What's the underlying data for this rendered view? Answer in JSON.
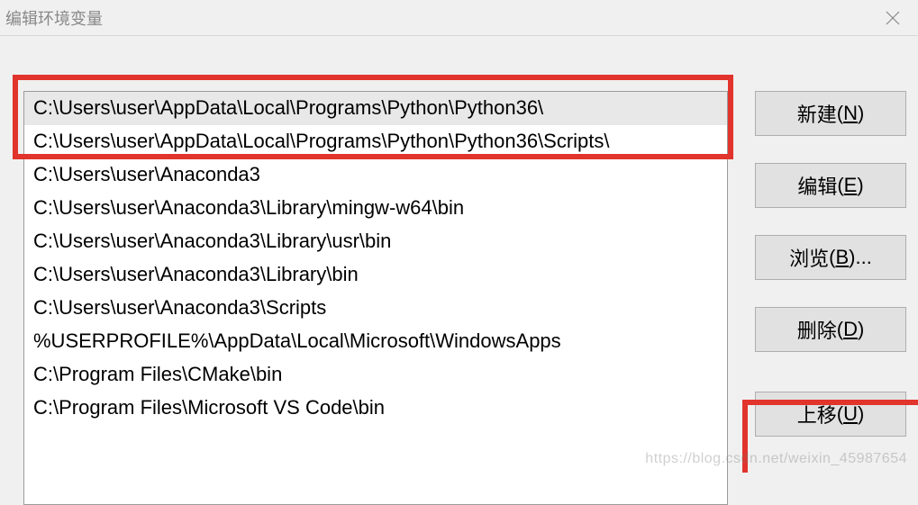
{
  "window": {
    "title": "编辑环境变量"
  },
  "list": {
    "items": [
      "C:\\Users\\user\\AppData\\Local\\Programs\\Python\\Python36\\",
      "C:\\Users\\user\\AppData\\Local\\Programs\\Python\\Python36\\Scripts\\",
      "C:\\Users\\user\\Anaconda3",
      "C:\\Users\\user\\Anaconda3\\Library\\mingw-w64\\bin",
      "C:\\Users\\user\\Anaconda3\\Library\\usr\\bin",
      "C:\\Users\\user\\Anaconda3\\Library\\bin",
      "C:\\Users\\user\\Anaconda3\\Scripts",
      "%USERPROFILE%\\AppData\\Local\\Microsoft\\WindowsApps",
      "C:\\Program Files\\CMake\\bin",
      "C:\\Program Files\\Microsoft VS Code\\bin"
    ],
    "selected_index": 0
  },
  "buttons": {
    "new": {
      "label": "新建",
      "accel": "N"
    },
    "edit": {
      "label": "编辑",
      "accel": "E"
    },
    "browse": {
      "label": "浏览",
      "accel": "B",
      "suffix": "..."
    },
    "delete": {
      "label": "删除",
      "accel": "D"
    },
    "moveup": {
      "label": "上移",
      "accel": "U"
    }
  },
  "watermark": "https://blog.csdn.net/weixin_45987654"
}
